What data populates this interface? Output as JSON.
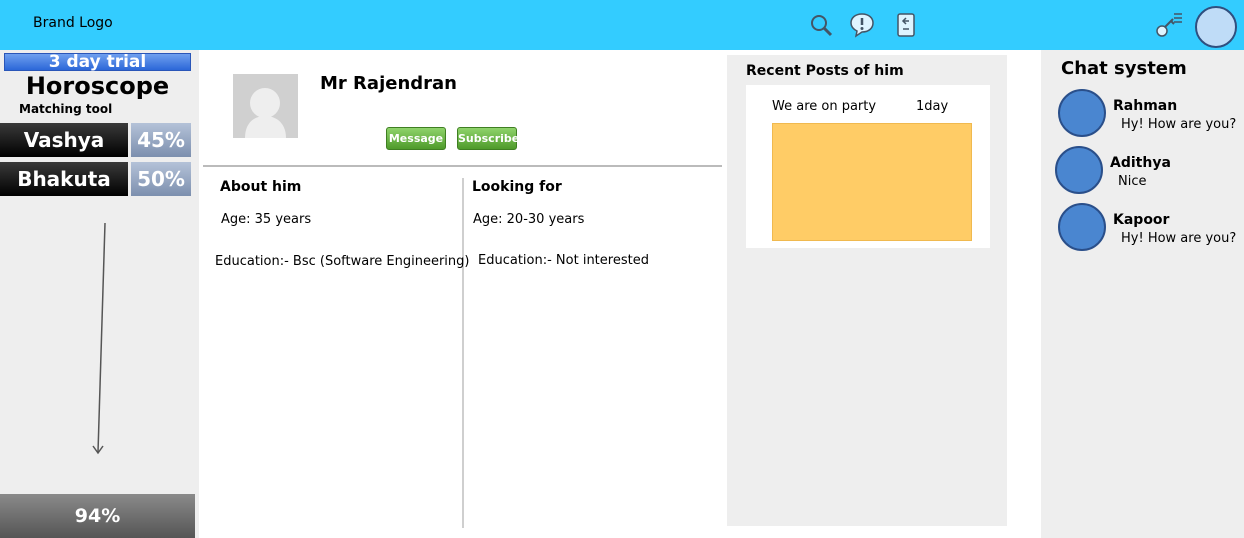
{
  "header": {
    "brand": "Brand Logo",
    "icons": [
      "search-icon",
      "alert-icon",
      "share-icon",
      "settings-icon"
    ],
    "accent": "#33ccff"
  },
  "sidebar": {
    "trial_label": "3 day trial",
    "title": "Horoscope",
    "subtitle": "Matching tool",
    "matches": [
      {
        "name": "Vashya",
        "percent": "45%"
      },
      {
        "name": "Bhakuta",
        "percent": "50%"
      }
    ],
    "total": "94%"
  },
  "profile": {
    "name": "Mr Rajendran",
    "message_label": "Message",
    "subscribe_label": "Subscribe",
    "about": {
      "title": "About him",
      "age": "Age: 35 years",
      "education": "Education:- Bsc (Software Engineering)"
    },
    "looking": {
      "title": "Looking for",
      "age": "Age: 20-30 years",
      "education": "Education:- Not interested"
    }
  },
  "posts": {
    "title": "Recent Posts of him",
    "items": [
      {
        "text": "We are on party",
        "time": "1day"
      }
    ]
  },
  "chat": {
    "title": "Chat system",
    "items": [
      {
        "name": "Rahman",
        "message": "Hy! How are you?"
      },
      {
        "name": "Adithya",
        "message": "Nice"
      },
      {
        "name": "Kapoor",
        "message": "Hy! How are you?"
      }
    ]
  }
}
